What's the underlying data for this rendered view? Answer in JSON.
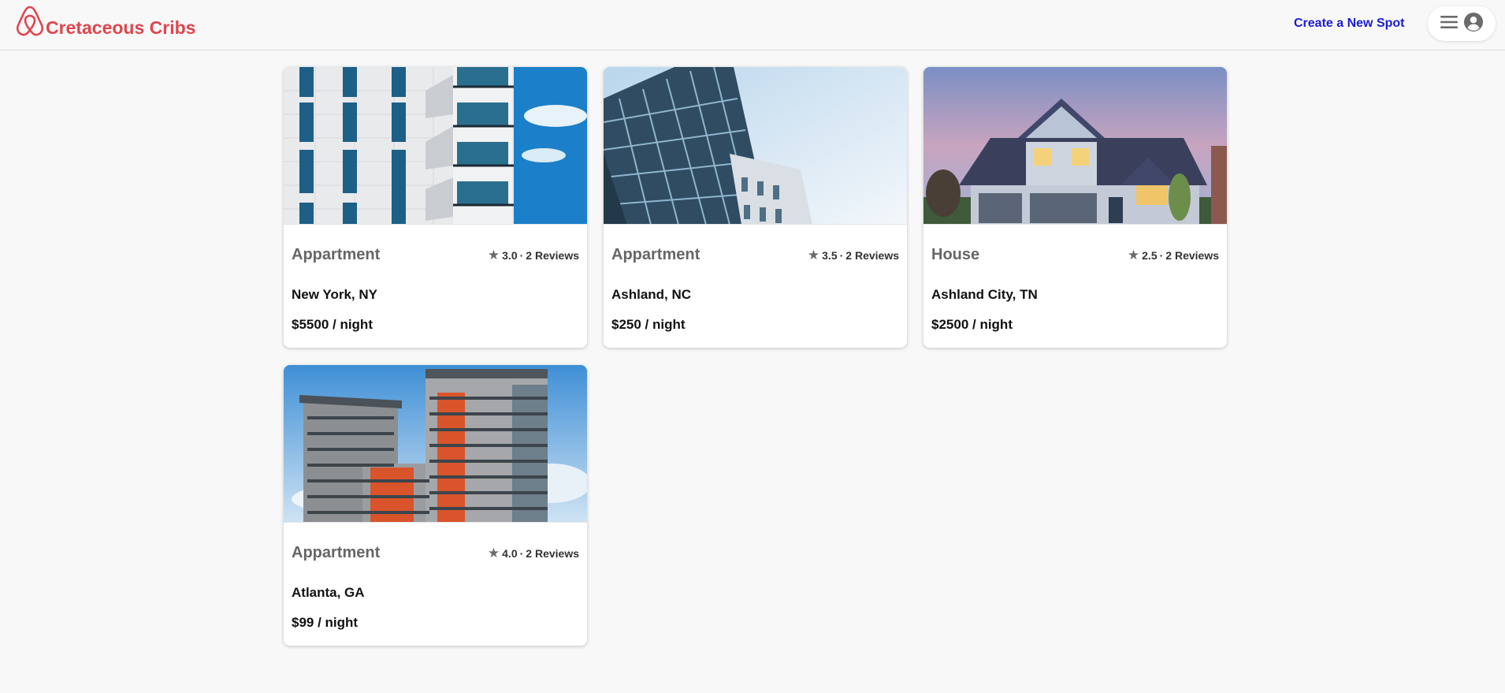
{
  "header": {
    "brand": "Cretaceous Cribs",
    "create_link": "Create a New Spot",
    "brand_color": "#e0454d",
    "link_color": "#1b1bd6"
  },
  "spots": [
    {
      "type": "Appartment",
      "rating": "3.0",
      "separator": "·",
      "reviews": "2 Reviews",
      "location": "New York, NY",
      "price": "$5500 / night",
      "image": "white-building-with-balconies"
    },
    {
      "type": "Appartment",
      "rating": "3.5",
      "separator": "·",
      "reviews": "2 Reviews",
      "location": "Ashland, NC",
      "price": "$250 / night",
      "image": "glass-highrise"
    },
    {
      "type": "House",
      "rating": "2.5",
      "separator": "·",
      "reviews": "2 Reviews",
      "location": "Ashland City, TN",
      "price": "$2500 / night",
      "image": "suburban-house-at-dusk"
    },
    {
      "type": "Appartment",
      "rating": "4.0",
      "separator": "·",
      "reviews": "2 Reviews",
      "location": "Atlanta, GA",
      "price": "$99 / night",
      "image": "colorful-apartment-towers"
    }
  ]
}
